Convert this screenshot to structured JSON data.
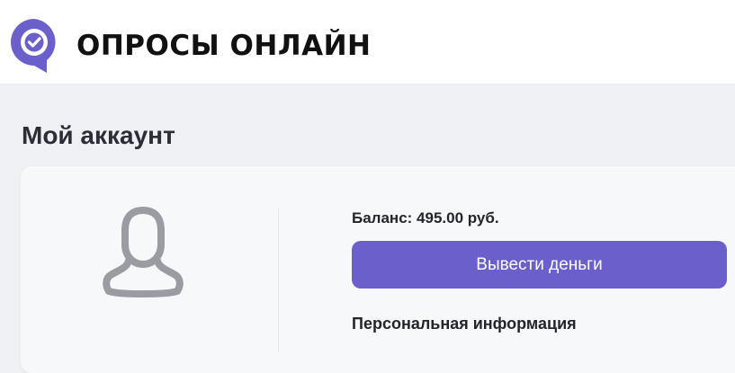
{
  "header": {
    "brand": "ОПРОСЫ ОНЛАЙН",
    "logo_icon": "check-chat-bubble-icon",
    "brand_color": "#6b5fcb"
  },
  "page": {
    "title": "Мой аккаунт"
  },
  "account": {
    "avatar_icon": "user-silhouette-icon",
    "balance_text": "Баланс: 495.00 руб.",
    "withdraw_label": "Вывести деньги",
    "withdraw_color": "#6b5fcb",
    "personal_info_title": "Персональная информация"
  }
}
